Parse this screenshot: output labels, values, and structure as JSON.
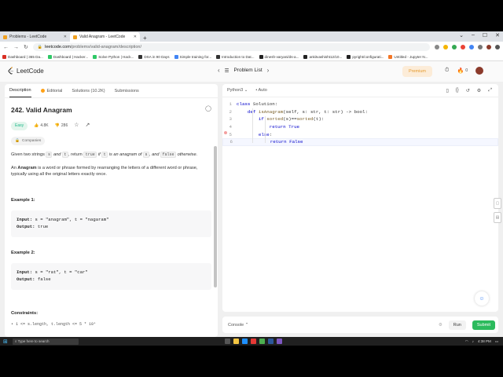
{
  "browser": {
    "tabs": [
      {
        "title": "Problems - LeetCode",
        "active": false
      },
      {
        "title": "Valid Anagram - LeetCode",
        "active": true
      }
    ],
    "url_host": "leetcode.com",
    "url_path": "/problems/valid-anagram/description/",
    "bookmarks": [
      "Dashboard | 365 Da...",
      "Dashboard | Hacker...",
      "Solve Python | Hack...",
      "DSA in 90 Days",
      "Simple training for...",
      "Introduction to Dat...",
      "dinesh-varyani/ds-a...",
      "ankitvashisht12/10...",
      "pyright/configurati...",
      "Untitled - Jupyter N..."
    ]
  },
  "topbar": {
    "logo": "LeetCode",
    "problem_list": "Problem List",
    "premium": "Premium",
    "streak": "0"
  },
  "left_tabs": [
    "Description",
    "Editorial",
    "Solutions (10.2K)",
    "Submissions"
  ],
  "problem": {
    "title": "242. Valid Anagram",
    "difficulty": "Easy",
    "likes": "4.8K",
    "dislikes": "286",
    "companies": "Companies",
    "desc1_a": "Given two strings",
    "desc1_s": "s",
    "desc1_and": "and",
    "desc1_t": "t",
    "desc1_b": ", return",
    "desc1_true": "true",
    "desc1_if": "if",
    "desc1_t2": "t",
    "desc1_c": "is an anagram of",
    "desc1_s2": "s",
    "desc1_d": ", and",
    "desc1_false": "false",
    "desc1_e": "otherwise.",
    "desc2_a": "An",
    "desc2_bold": "Anagram",
    "desc2_b": "is a word or phrase formed by rearranging the letters of a different word or phrase, typically using all the original letters exactly once.",
    "examples": [
      {
        "title": "Example 1:",
        "input_label": "Input:",
        "input": " s = \"anagram\", t = \"nagaram\"",
        "output_label": "Output:",
        "output": " true"
      },
      {
        "title": "Example 2:",
        "input_label": "Input:",
        "input": " s = \"rat\", t = \"car\"",
        "output_label": "Output:",
        "output": " false"
      }
    ],
    "constraints_title": "Constraints:",
    "constraint1": "1 <= s.length, t.length <= 5 * 10⁴"
  },
  "editor": {
    "language": "Python3",
    "mode": "Auto",
    "line_numbers": [
      "1",
      "2",
      "3",
      "4",
      "5",
      "6"
    ]
  },
  "console": {
    "label": "Console",
    "run": "Run",
    "submit": "Submit"
  },
  "taskbar": {
    "search": "Type here to search",
    "time": "4:38 PM"
  },
  "colors": {
    "easy": "#1cb88a",
    "submit": "#2cbb5d",
    "premium": "#e59a2e"
  }
}
